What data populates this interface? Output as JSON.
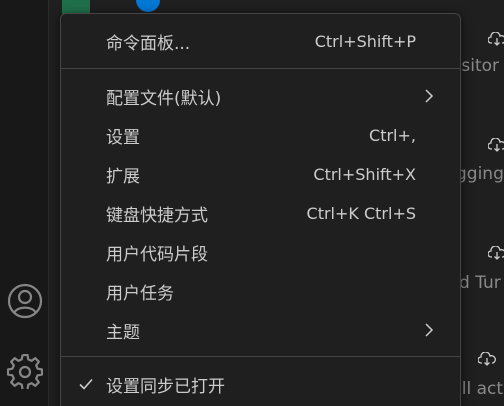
{
  "background": {
    "snippets": [
      "ositor",
      "gging",
      "d Tur",
      "ill act"
    ]
  },
  "activity_bar": {
    "accounts_icon": "accounts-icon",
    "manage_icon": "gear-icon"
  },
  "menu": {
    "items": [
      {
        "label": "命令面板...",
        "keybinding": "Ctrl+Shift+P"
      },
      {
        "label": "配置文件(默认)",
        "submenu": true
      },
      {
        "label": "设置",
        "keybinding": "Ctrl+,"
      },
      {
        "label": "扩展",
        "keybinding": "Ctrl+Shift+X"
      },
      {
        "label": "键盘快捷方式",
        "keybinding": "Ctrl+K Ctrl+S"
      },
      {
        "label": "用户代码片段"
      },
      {
        "label": "用户任务"
      },
      {
        "label": "主题",
        "submenu": true
      },
      {
        "label": "设置同步已打开",
        "checked": true
      }
    ]
  },
  "colors": {
    "menu_bg": "#1f1f1f",
    "menu_border": "#454545",
    "text": "#cccccc"
  }
}
